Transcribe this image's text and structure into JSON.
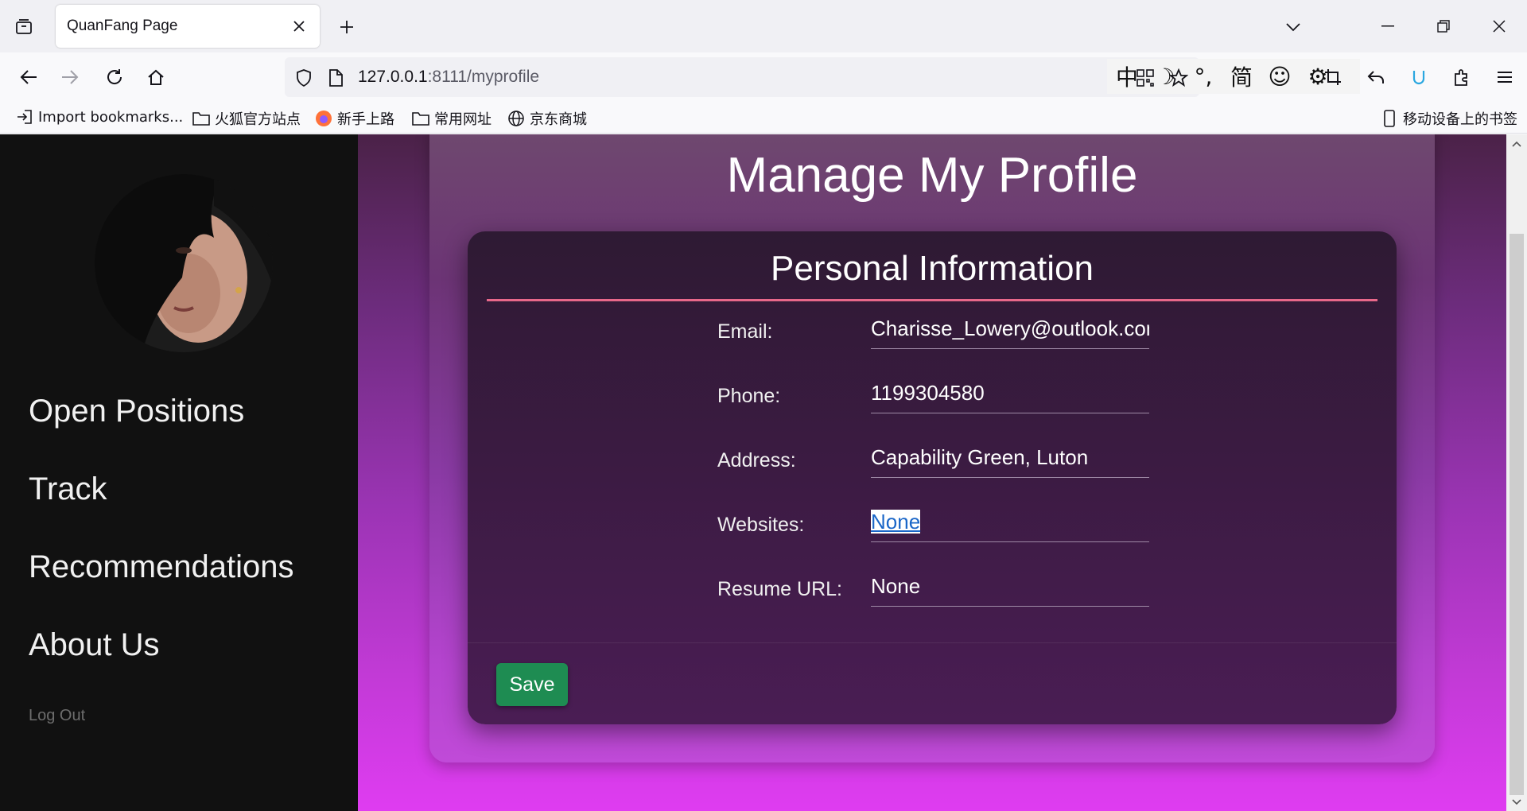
{
  "browser": {
    "tab_title": "QuanFang Page",
    "url_host": "127.0.0.1",
    "url_rest": ":8111/myprofile",
    "ime": [
      "中",
      "☽",
      "°,",
      "简",
      "☺",
      "⚙"
    ],
    "bookmarks": [
      {
        "label": "Import bookmarks...",
        "icon": "import-icon"
      },
      {
        "label": "火狐官方站点",
        "icon": "folder-icon"
      },
      {
        "label": "新手上路",
        "icon": "firefox-icon"
      },
      {
        "label": "常用网址",
        "icon": "folder-icon"
      },
      {
        "label": "京东商城",
        "icon": "globe-icon"
      }
    ],
    "mobile_bookmarks": "移动设备上的书签"
  },
  "sidebar": {
    "links": [
      "Open Positions",
      "Track",
      "Recommendations",
      "About Us"
    ],
    "logout": "Log Out"
  },
  "main": {
    "title": "Manage My Profile",
    "section_title": "Personal Information",
    "fields": [
      {
        "label": "Email:",
        "value": "Charisse_Lowery@outlook.con"
      },
      {
        "label": "Phone:",
        "value": "1199304580"
      },
      {
        "label": "Address:",
        "value": "Capability Green, Luton"
      },
      {
        "label": "Websites:",
        "value": "None"
      },
      {
        "label": "Resume URL:",
        "value": "None"
      }
    ],
    "save_label": "Save"
  },
  "colors": {
    "sidebar_bg": "#111111",
    "accent_line": "#e8688a",
    "save_button": "#1e8c52"
  }
}
